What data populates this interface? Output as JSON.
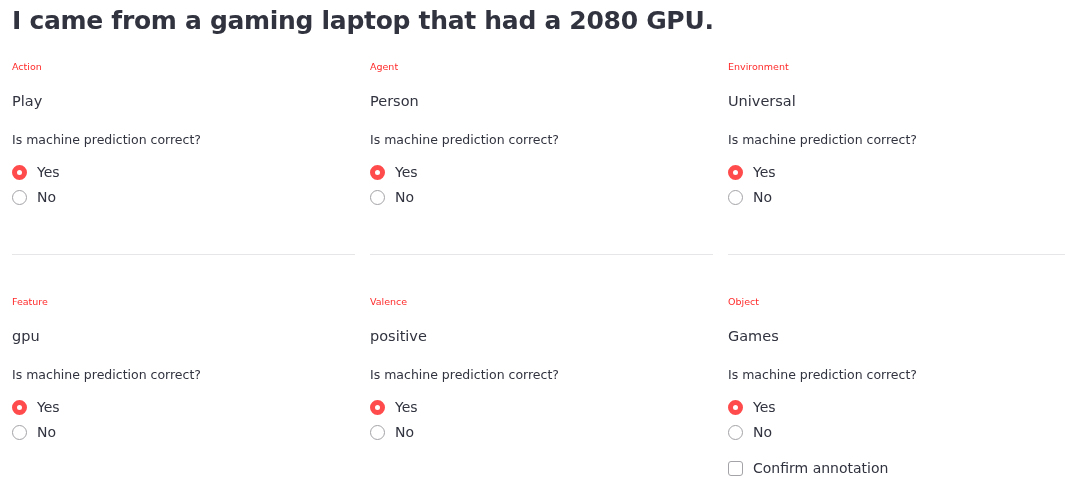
{
  "title": "I came from a gaming laptop that had a 2080 GPU.",
  "rows": [
    {
      "cards": [
        {
          "label": "Action",
          "value": "Play",
          "question": "Is machine prediction correct?",
          "options": [
            {
              "label": "Yes",
              "selected": true
            },
            {
              "label": "No",
              "selected": false
            }
          ]
        },
        {
          "label": "Agent",
          "value": "Person",
          "question": "Is machine prediction correct?",
          "options": [
            {
              "label": "Yes",
              "selected": true
            },
            {
              "label": "No",
              "selected": false
            }
          ]
        },
        {
          "label": "Environment",
          "value": "Universal",
          "question": "Is machine prediction correct?",
          "options": [
            {
              "label": "Yes",
              "selected": true
            },
            {
              "label": "No",
              "selected": false
            }
          ]
        }
      ]
    },
    {
      "cards": [
        {
          "label": "Feature",
          "value": "gpu",
          "question": "Is machine prediction correct?",
          "options": [
            {
              "label": "Yes",
              "selected": true
            },
            {
              "label": "No",
              "selected": false
            }
          ]
        },
        {
          "label": "Valence",
          "value": "positive",
          "question": "Is machine prediction correct?",
          "options": [
            {
              "label": "Yes",
              "selected": true
            },
            {
              "label": "No",
              "selected": false
            }
          ]
        },
        {
          "label": "Object",
          "value": "Games",
          "question": "Is machine prediction correct?",
          "options": [
            {
              "label": "Yes",
              "selected": true
            },
            {
              "label": "No",
              "selected": false
            }
          ],
          "confirm": {
            "label": "Confirm annotation",
            "checked": false
          }
        }
      ]
    }
  ]
}
